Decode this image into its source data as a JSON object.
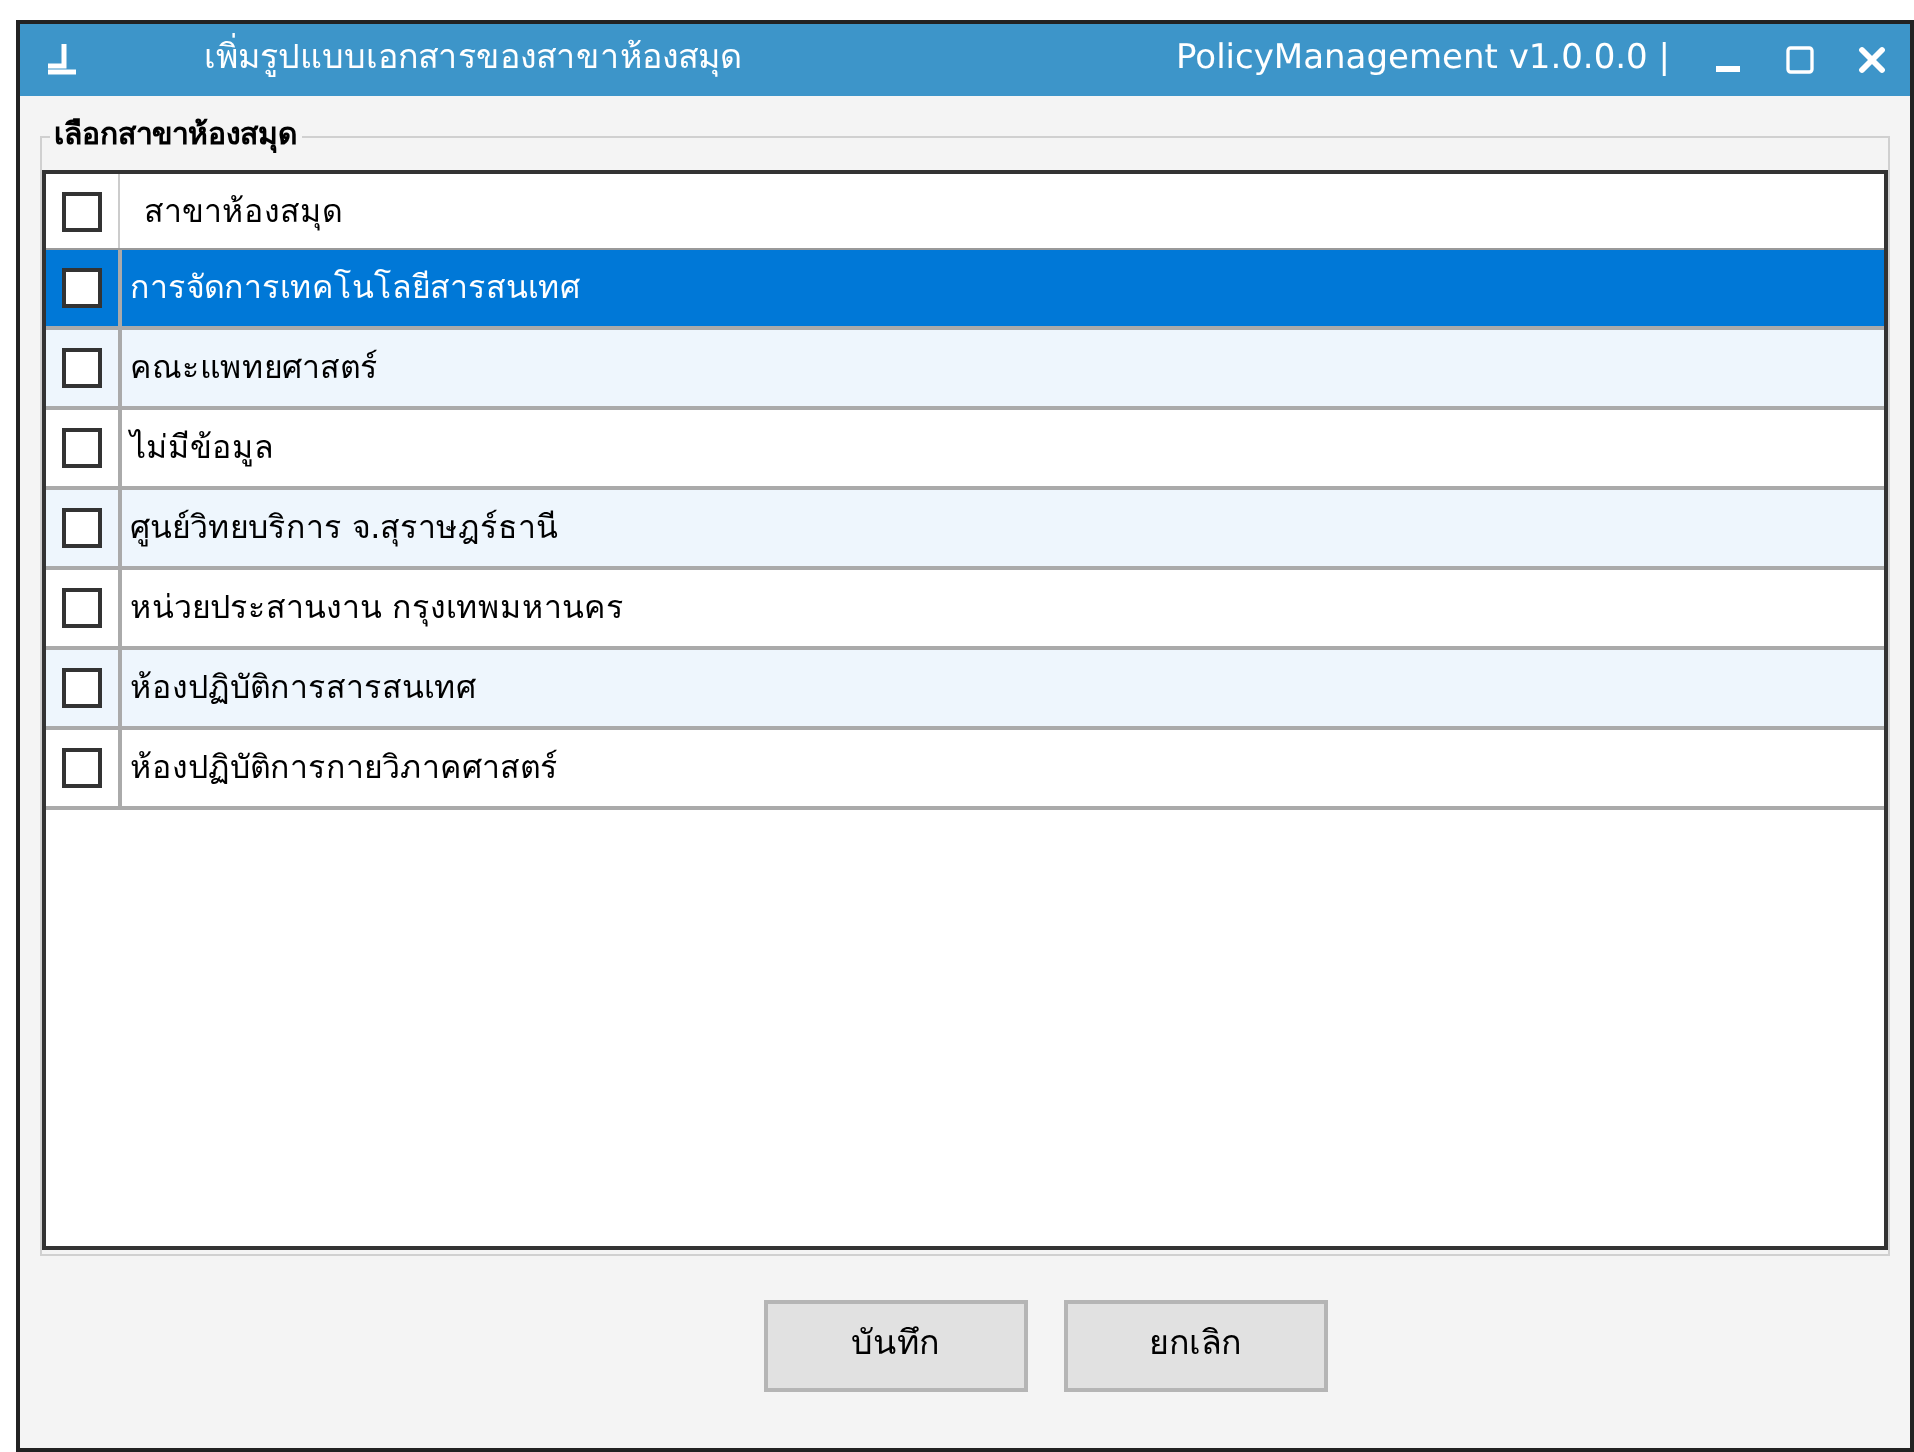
{
  "window": {
    "title": "เพิ่มรูปแบบเอกสารของสาขาห้องสมุด",
    "app_name": "PolicyManagement v1.0.0.0 |"
  },
  "group": {
    "label": "เลือกสาขาห้องสมุด"
  },
  "table": {
    "header": {
      "checked": false,
      "label": "สาขาห้องสมุด"
    },
    "rows": [
      {
        "name": "การจัดการเทคโนโลยีสารสนเทศ",
        "checked": false,
        "selected": true
      },
      {
        "name": "คณะแพทยศาสตร์",
        "checked": false,
        "selected": false
      },
      {
        "name": "ไม่มีข้อมูล",
        "checked": false,
        "selected": false
      },
      {
        "name": "ศูนย์วิทยบริการ จ.สุราษฎร์ธานี",
        "checked": false,
        "selected": false
      },
      {
        "name": "หน่วยประสานงาน กรุงเทพมหานคร",
        "checked": false,
        "selected": false
      },
      {
        "name": "ห้องปฏิบัติการสารสนเทศ",
        "checked": false,
        "selected": false
      },
      {
        "name": "ห้องปฏิบัติการกายวิภาคศาสตร์",
        "checked": false,
        "selected": false
      }
    ]
  },
  "buttons": [
    {
      "label": "บันทึก"
    },
    {
      "label": "ยกเลิก"
    }
  ]
}
